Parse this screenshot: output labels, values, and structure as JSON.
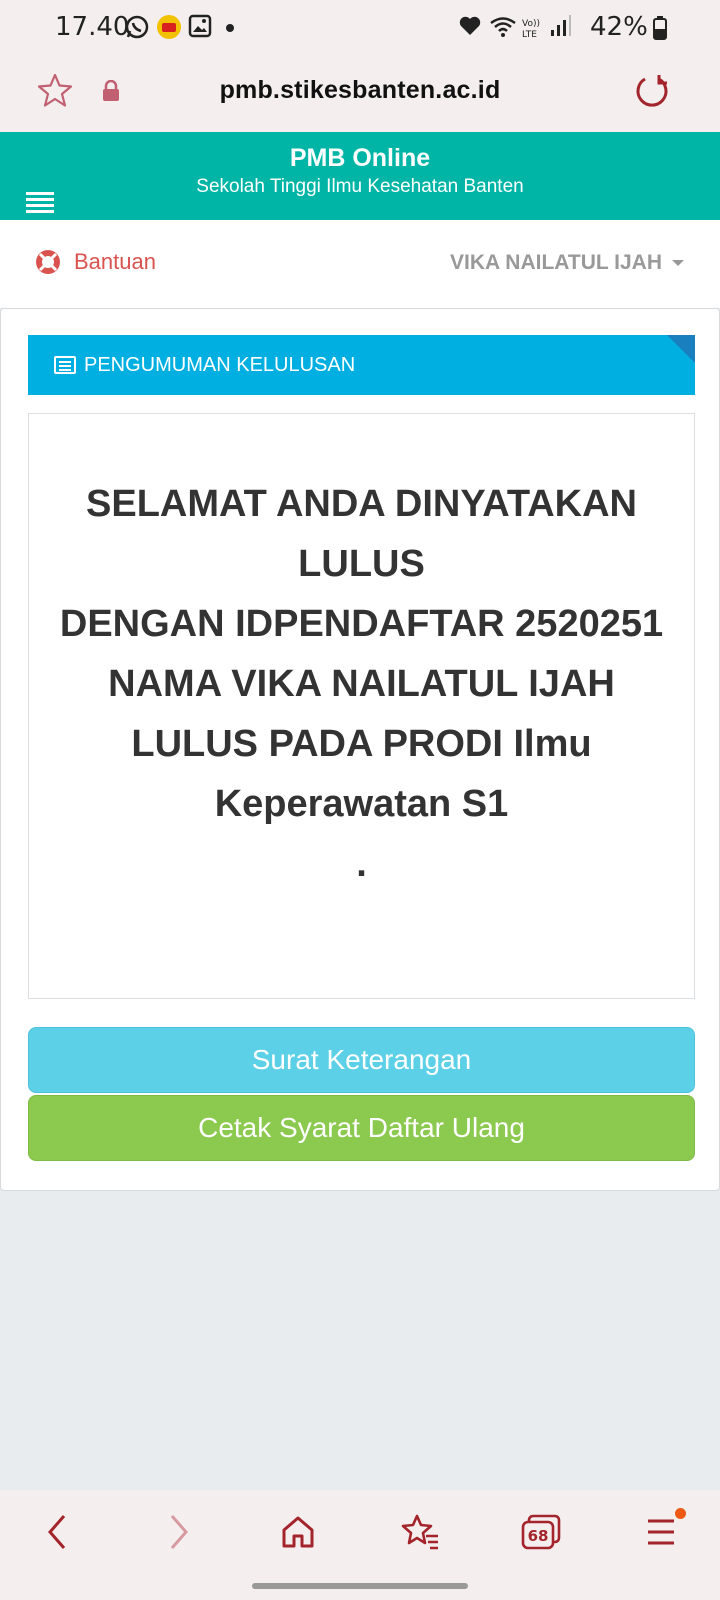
{
  "status_bar": {
    "time": "17.40",
    "battery_percent": "42%",
    "icons": [
      "whatsapp-icon",
      "app-notification-icon",
      "gallery-icon",
      "dot-icon",
      "heart-icon",
      "wifi-icon",
      "volte-icon",
      "signal-icon",
      "battery-icon"
    ]
  },
  "browser": {
    "url": "pmb.stikesbanten.ac.id",
    "bottom_nav": {
      "tab_count": "68"
    }
  },
  "app_header": {
    "title": "PMB Online",
    "subtitle": "Sekolah Tinggi Ilmu Kesehatan Banten"
  },
  "nav": {
    "help_label": "Bantuan",
    "user_name": "VIKA NAILATUL IJAH"
  },
  "panel": {
    "section_title": "PENGUMUMAN KELULUSAN",
    "announcement": {
      "line1": "SELAMAT ANDA DINYATAKAN LULUS",
      "line2": "DENGAN IDPENDAFTAR 2520251 NAMA VIKA NAILATUL IJAH",
      "line3": "LULUS PADA PRODI Ilmu Keperawatan S1",
      "line4": "."
    },
    "buttons": {
      "letter": "Surat Keterangan",
      "print": "Cetak Syarat Daftar Ulang"
    }
  },
  "colors": {
    "header_teal": "#00b5a6",
    "section_blue": "#00afe1",
    "button_info": "#5bd0e6",
    "button_success": "#8bc94f",
    "help_red": "#d9534f",
    "browser_icon": "#a3242a"
  }
}
